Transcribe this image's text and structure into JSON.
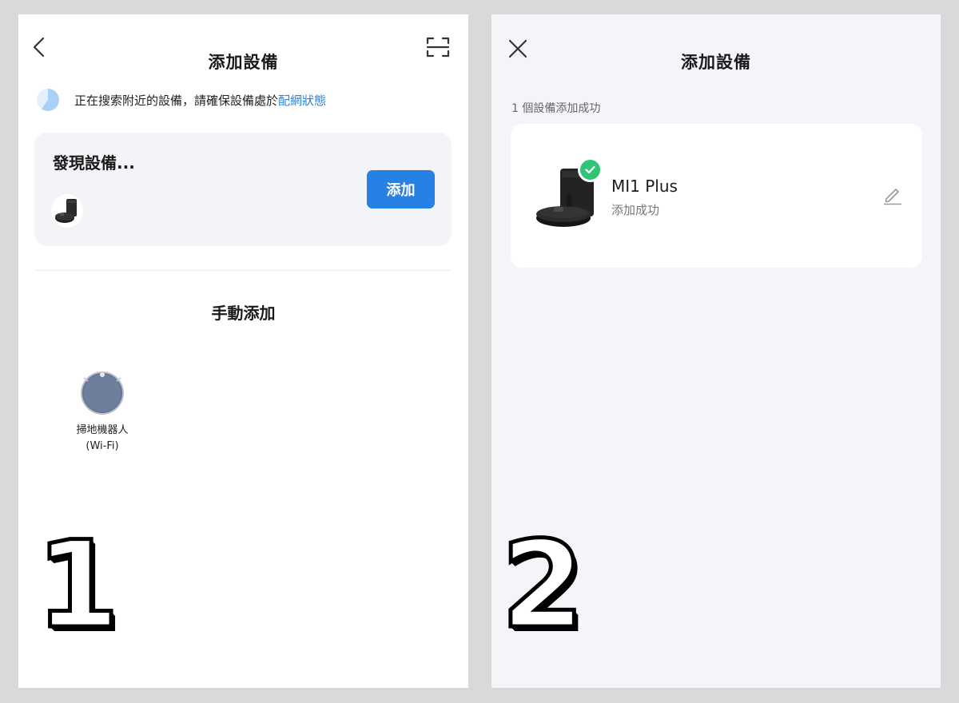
{
  "screen1": {
    "title": "添加設備",
    "search_text": "正在搜索附近的設備，請確保設備處於",
    "search_link": "配網狀態",
    "discover_title": "發現設備...",
    "add_button": "添加",
    "manual_title": "手動添加",
    "manual_items": [
      {
        "label_line1": "掃地機器人",
        "label_line2": "(Wi-Fi)",
        "icon": "robot-vacuum-icon"
      }
    ],
    "step_number": "1"
  },
  "screen2": {
    "title": "添加設備",
    "success_count": "1 個設備添加成功",
    "device": {
      "name": "MI1 Plus",
      "status": "添加成功"
    },
    "step_number": "2"
  },
  "colors": {
    "accent": "#2780e3",
    "success": "#30c575",
    "link": "#2a84df"
  }
}
